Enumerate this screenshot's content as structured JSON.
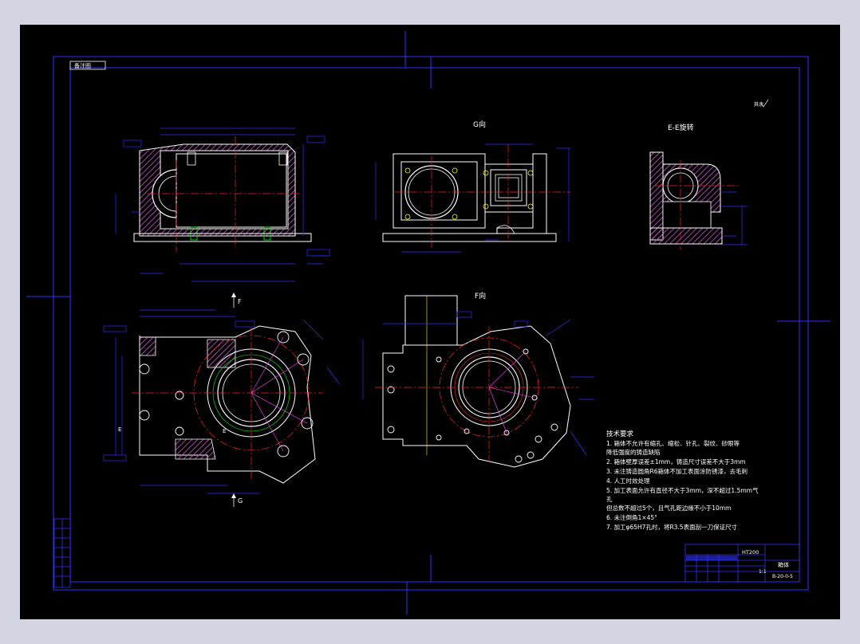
{
  "drawing": {
    "corner_tag": "备注图",
    "view_g_label": "G向",
    "view_ee_label": "E-E旋转",
    "view_f_label": "F向",
    "arrow_f_label": "F",
    "arrow_g_label": "G",
    "section_e_label": "E",
    "section_e2_label": "E",
    "roughness_note": "其余"
  },
  "tech_req": {
    "title": "技术要求",
    "lines": [
      "1.  箱体不允许有缩孔、缩松、针孔、裂纹、砂眼等",
      "     降低强度的铸造缺陷",
      "2.  箱体壁厚误差±1mm，铸造尺寸误差不大于3mm",
      "3.  未注铸造圆角R6箱体不加工表面涂防锈漆，去毛刺",
      "4.  人工时效处理",
      "5.  加工表面允许有直径不大于3mm，深不超过1.5mm气",
      "孔",
      "     但总数不超过5个，且气孔距边缘不小于10mm",
      "6.  未注倒角1×45°",
      "7.  加工φ65H7孔时，将R3.5表面刮一刀保证尺寸"
    ]
  },
  "title_block": {
    "material": "HT200",
    "part_name": "箱体",
    "scale": "1:1",
    "drawing_no": "B-20-0-5"
  },
  "colors": {
    "background": "#000000",
    "frame": "#0000ff",
    "outline": "#ffffff",
    "centerline": "#ff0000",
    "dimension": "#0000ff",
    "hatch": "#cc55cc",
    "thread": "#00ff00",
    "holes": "#ffff00"
  }
}
